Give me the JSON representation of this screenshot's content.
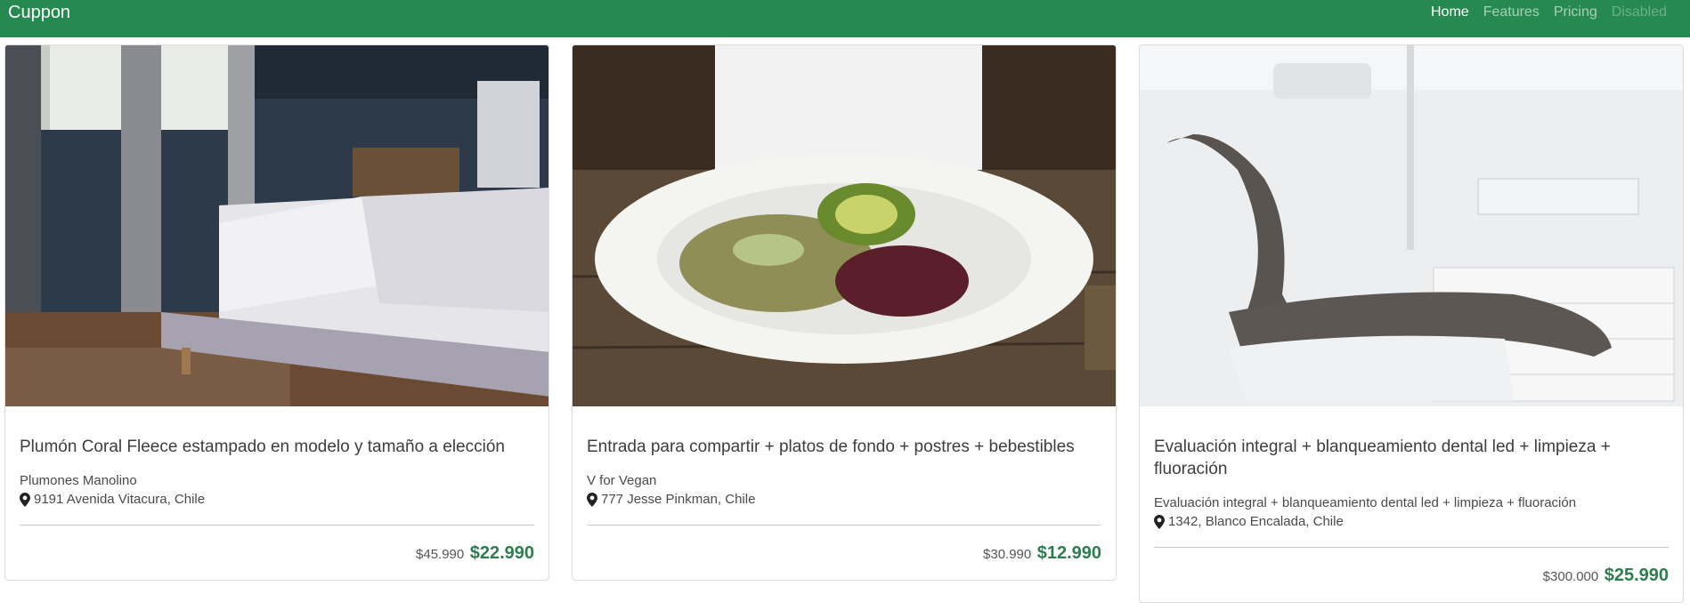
{
  "navbar": {
    "brand": "Cuppon",
    "links": [
      {
        "label": "Home",
        "state": "active"
      },
      {
        "label": "Features",
        "state": "normal"
      },
      {
        "label": "Pricing",
        "state": "normal"
      },
      {
        "label": "Disabled",
        "state": "disabled"
      }
    ]
  },
  "colors": {
    "navbar_bg": "#268a50",
    "price_accent": "#2e7d4f"
  },
  "cards": [
    {
      "image_icon": "bedroom-photo",
      "title": "Plumón Coral Fleece estampado en modelo y tamaño a elección",
      "vendor": "Plumones Manolino",
      "address": "9191 Avenida Vitacura, Chile",
      "old_price": "$45.990",
      "new_price": "$22.990"
    },
    {
      "image_icon": "salad-plate-photo",
      "title": "Entrada para compartir + platos de fondo + postres + bebestibles",
      "vendor": "V for Vegan",
      "address": "777 Jesse Pinkman, Chile",
      "old_price": "$30.990",
      "new_price": "$12.990"
    },
    {
      "image_icon": "dental-chair-photo",
      "title": "Evaluación integral + blanqueamiento dental led + limpieza + fluoración",
      "vendor": "Evaluación integral + blanqueamiento dental led + limpieza + fluoración",
      "address": "1342, Blanco Encalada, Chile",
      "old_price": "$300.000",
      "new_price": "$25.990"
    }
  ]
}
